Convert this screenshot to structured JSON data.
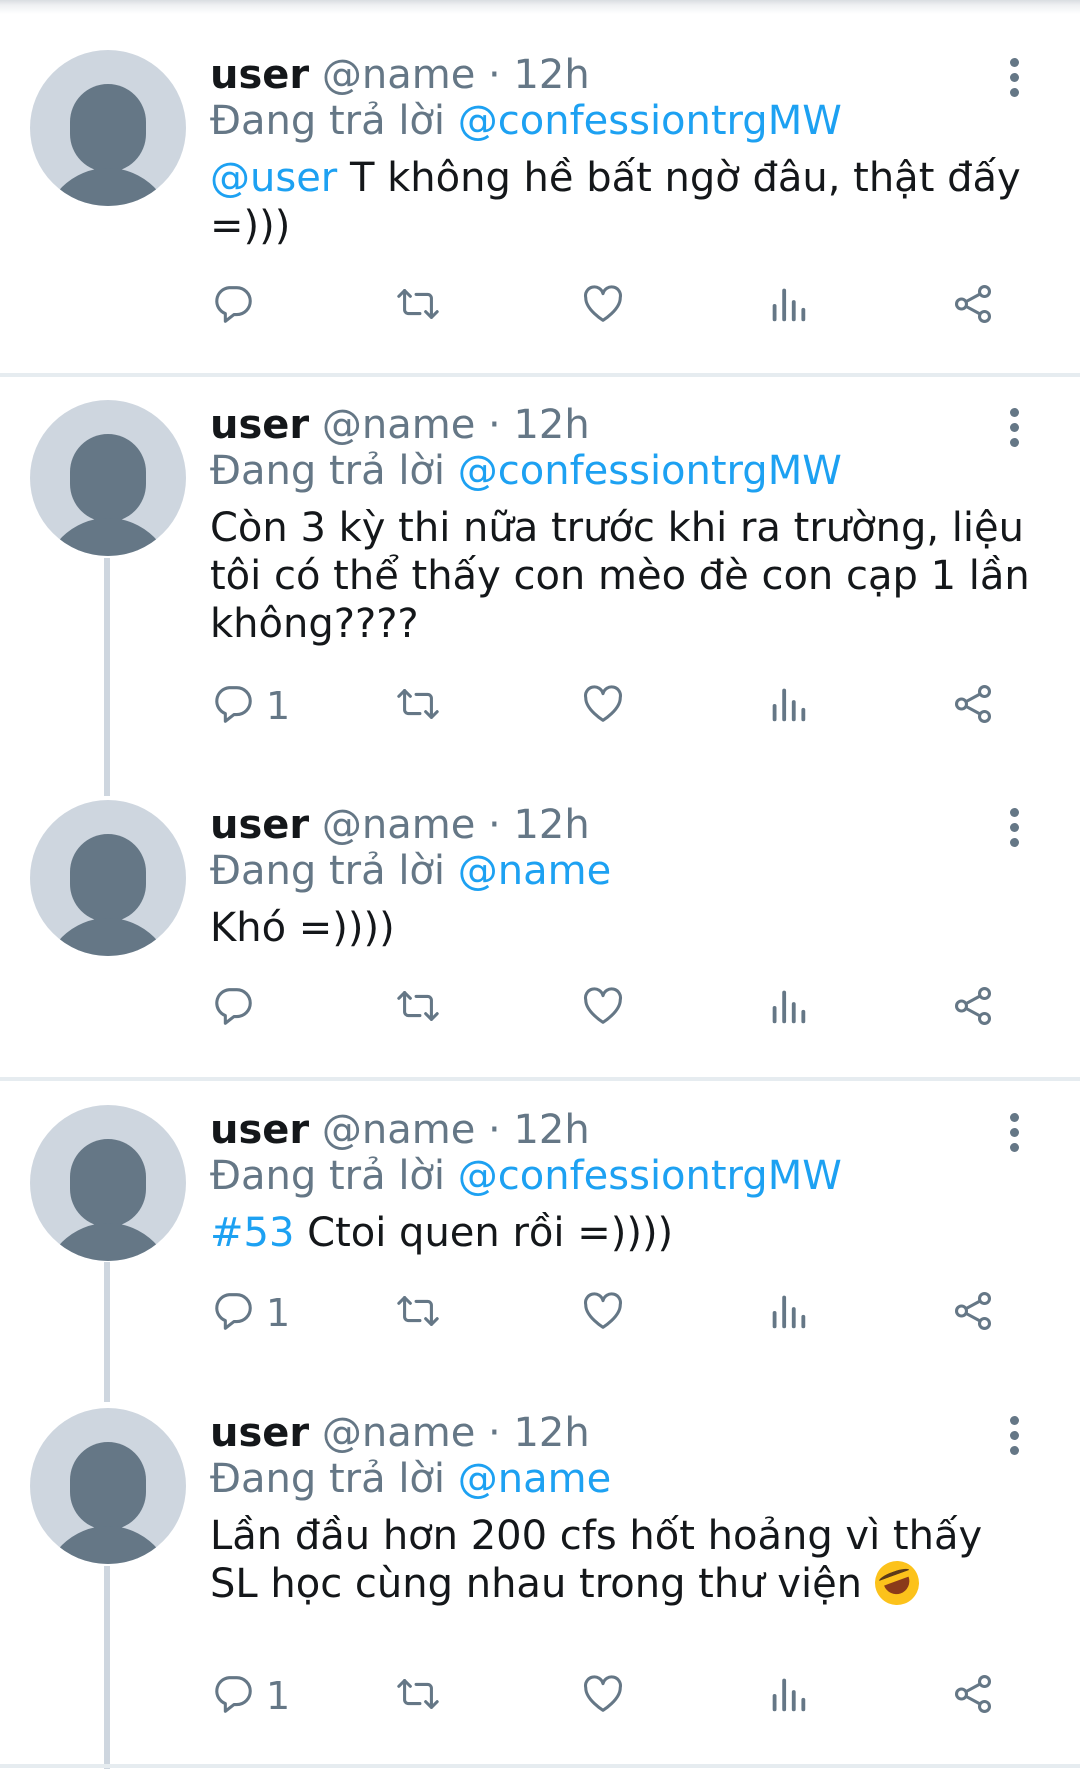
{
  "tweets": [
    {
      "name": "user",
      "handle": "@name",
      "dot": "·",
      "time": "12h",
      "replying_prefix": "Đang trả lời",
      "replying_to": "@confessiontrgMW",
      "mention": "@user",
      "text": " T không hề bất ngờ đâu, thật đấy =)))",
      "reply_count": ""
    },
    {
      "name": "user",
      "handle": "@name",
      "dot": "·",
      "time": "12h",
      "replying_prefix": "Đang trả lời",
      "replying_to": "@confessiontrgMW",
      "mention": "",
      "text": "Còn 3 kỳ thi nữa trước khi ra trường, liệu tôi có thể thấy con mèo đè con cạp 1 lần không????",
      "reply_count": "1"
    },
    {
      "name": "user",
      "handle": "@name",
      "dot": "·",
      "time": "12h",
      "replying_prefix": "Đang trả lời",
      "replying_to": "@name",
      "mention": "",
      "text": "Khó =))))",
      "reply_count": ""
    },
    {
      "name": "user",
      "handle": "@name",
      "dot": "·",
      "time": "12h",
      "replying_prefix": "Đang trả lời",
      "replying_to": "@confessiontrgMW",
      "mention": "#53",
      "text": " Ctoi quen rồi =))))",
      "reply_count": "1"
    },
    {
      "name": "user",
      "handle": "@name",
      "dot": "·",
      "time": "12h",
      "replying_prefix": "Đang trả lời",
      "replying_to": "@name",
      "mention": "",
      "text": "Lần đầu hơn 200 cfs hốt hoảng vì thấy SL học cùng nhau trong thư viện",
      "emoji": "rolling-on-floor-laughing",
      "reply_count": "1"
    }
  ],
  "icons": {
    "reply": "reply-icon",
    "retweet": "retweet-icon",
    "like": "like-icon",
    "analytics": "analytics-icon",
    "share": "share-icon",
    "more": "more-icon"
  },
  "colors": {
    "link": "#1da1f2",
    "secondary": "#657786",
    "avatar": "#ced6df",
    "separator": "#e6ecf0"
  }
}
